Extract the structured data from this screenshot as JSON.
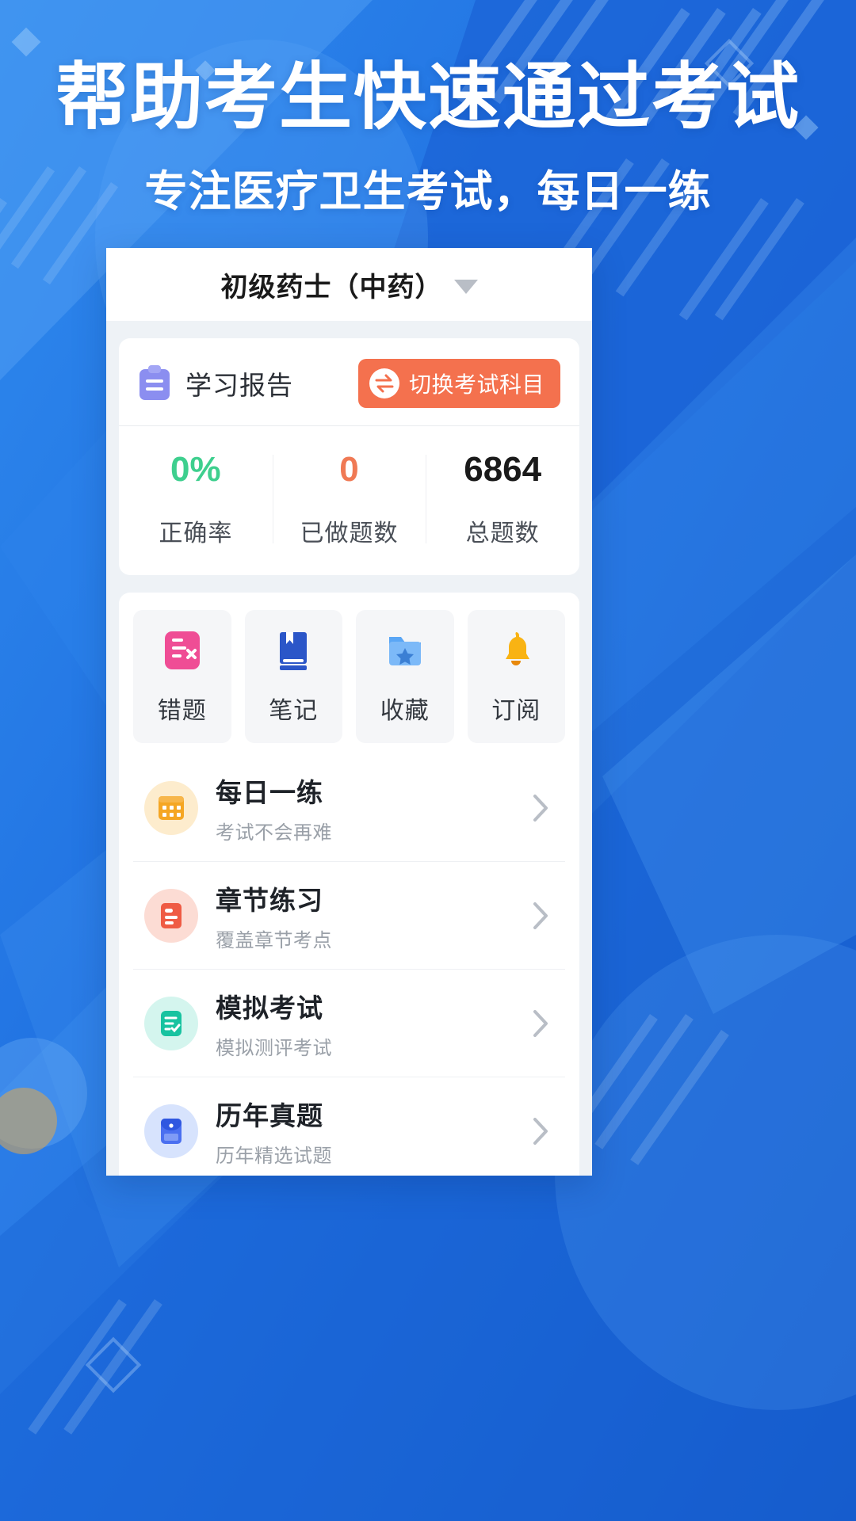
{
  "hero": {
    "title": "帮助考生快速通过考试",
    "subtitle": "专注医疗卫生考试，每日一练"
  },
  "colors": {
    "bg_blue": "#1565d8",
    "bg_blue_light": "#2f8aee",
    "accent_orange": "#f4714e",
    "stat_green": "#3ecf8e",
    "stat_orange": "#f07a55",
    "stat_black": "#1a1a1a"
  },
  "phone": {
    "nav": {
      "title": "初级药士（中药）",
      "caret_icon": "chevron-down-icon"
    },
    "report": {
      "icon": "clipboard-icon",
      "title": "学习报告",
      "switch_button": {
        "icon": "swap-icon",
        "label": "切换考试科目"
      },
      "stats": [
        {
          "value": "0%",
          "label": "正确率",
          "color": "#3ecf8e"
        },
        {
          "value": "0",
          "label": "已做题数",
          "color": "#f07a55"
        },
        {
          "value": "6864",
          "label": "总题数",
          "color": "#1a1a1a"
        }
      ]
    },
    "tiles": [
      {
        "icon": "wrong-question-icon",
        "label": "错题"
      },
      {
        "icon": "note-book-icon",
        "label": "笔记"
      },
      {
        "icon": "favorite-folder-icon",
        "label": "收藏"
      },
      {
        "icon": "bell-icon",
        "label": "订阅"
      }
    ],
    "menu_rows": [
      {
        "icon": "calendar-icon",
        "title": "每日一练",
        "subtitle": "考试不会再难"
      },
      {
        "icon": "chapter-icon",
        "title": "章节练习",
        "subtitle": "覆盖章节考点"
      },
      {
        "icon": "mock-exam-icon",
        "title": "模拟考试",
        "subtitle": "模拟测评考试"
      },
      {
        "icon": "past-paper-icon",
        "title": "历年真题",
        "subtitle": "历年精选试题"
      }
    ],
    "chevron_icon": "chevron-right-icon"
  }
}
